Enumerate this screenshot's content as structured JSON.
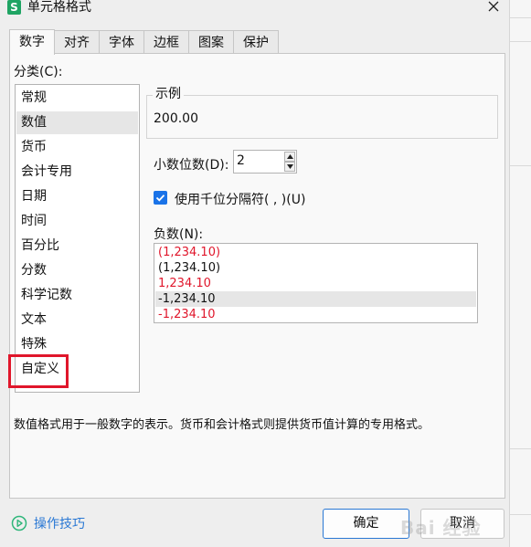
{
  "window": {
    "title": "单元格格式",
    "app_icon_letter": "S"
  },
  "tabs": [
    {
      "label": "数字",
      "active": true
    },
    {
      "label": "对齐"
    },
    {
      "label": "字体"
    },
    {
      "label": "边框"
    },
    {
      "label": "图案"
    },
    {
      "label": "保护"
    }
  ],
  "category": {
    "label": "分类(C):",
    "items": [
      "常规",
      "数值",
      "货币",
      "会计专用",
      "日期",
      "时间",
      "百分比",
      "分数",
      "科学记数",
      "文本",
      "特殊",
      "自定义"
    ],
    "selected": "数值",
    "highlighted": "自定义"
  },
  "sample": {
    "title": "示例",
    "value": "200.00"
  },
  "decimal": {
    "label": "小数位数(D):",
    "value": "2"
  },
  "separator": {
    "label": "使用千位分隔符( , )(U)",
    "checked": true
  },
  "negative": {
    "label": "负数(N):",
    "items": [
      "(1,234.10)",
      "(1,234.10)",
      "1,234.10",
      "-1,234.10",
      "-1,234.10"
    ],
    "selected_index": 3
  },
  "description": "数值格式用于一般数字的表示。货币和会计格式则提供货币值计算的专用格式。",
  "footer": {
    "tips_label": "操作技巧",
    "ok_label": "确定",
    "cancel_label": "取消"
  },
  "colors": {
    "accent": "#1a73e8",
    "negative_red": "#e0162b",
    "highlight_red": "#e0162b",
    "link_blue": "#2a78d4",
    "app_icon_green": "#1fa463"
  }
}
